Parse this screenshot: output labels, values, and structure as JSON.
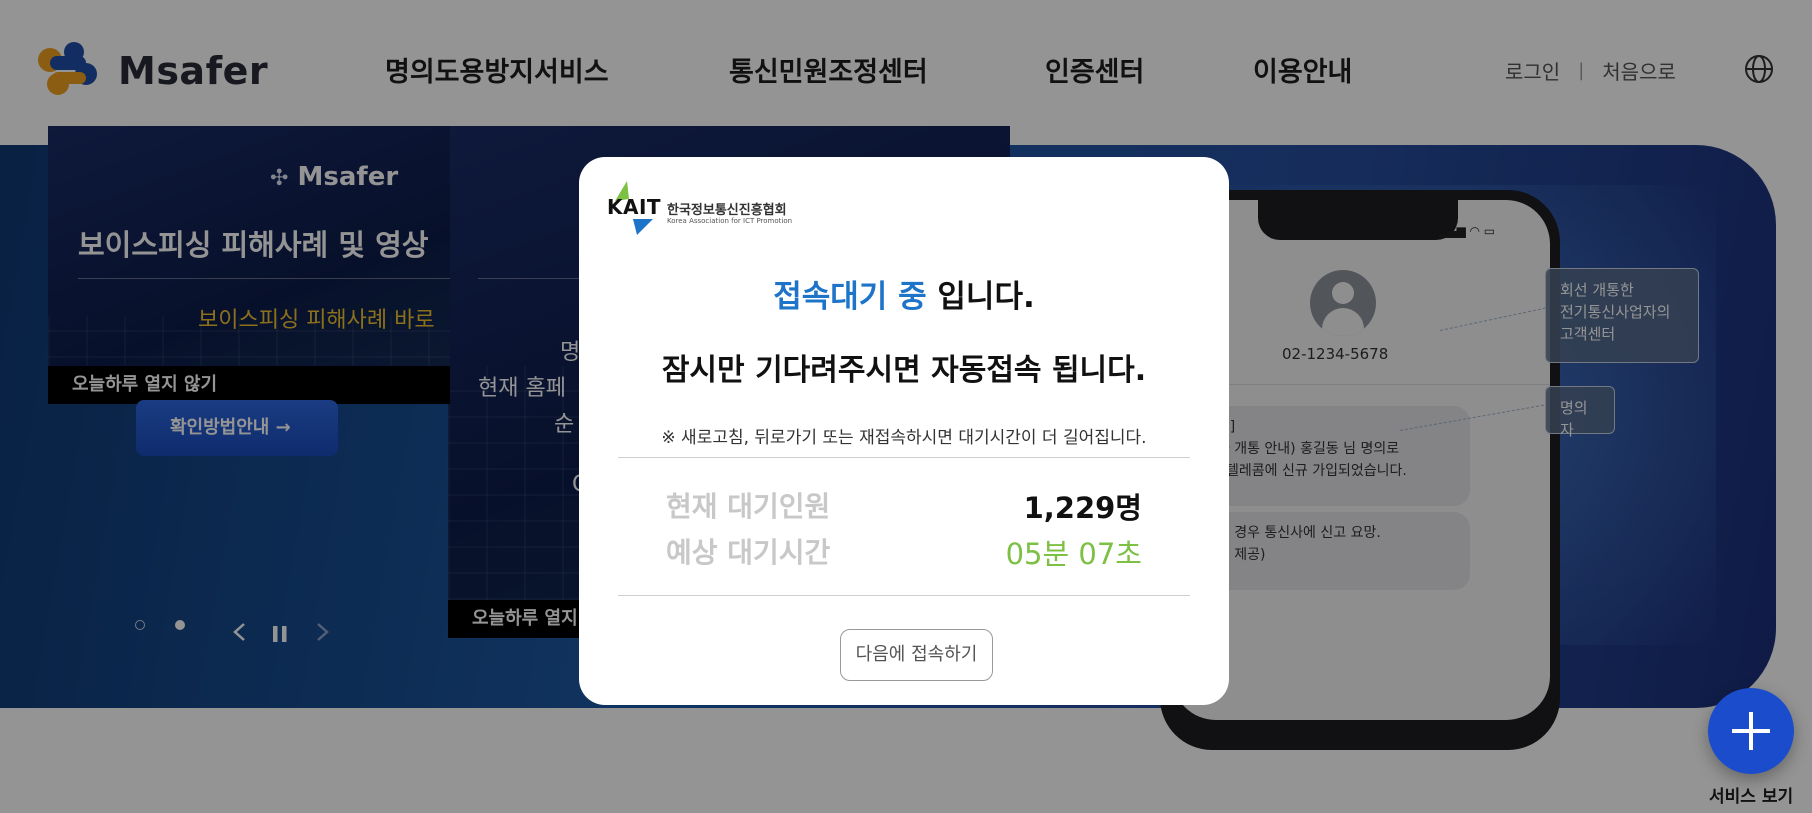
{
  "header": {
    "logo_text": "Msafer",
    "nav": [
      "명의도용방지서비스",
      "통신민원조정센터",
      "인증센터",
      "이용안내"
    ],
    "login_label": "로그인",
    "home_label": "처음으로",
    "globe_icon": "globe-icon"
  },
  "popup1": {
    "logo_text": "Msafer",
    "title": "보이스피싱 피해사례 및 영상",
    "subtitle": "보이스피싱 피해사례 바로",
    "close_today_label": "오늘하루 열지 않기",
    "confirm_label": "확인방법안내 →",
    "pager": {
      "dots": 2,
      "active_dot": 2
    }
  },
  "popup2": {
    "line1": "명",
    "line2": "현재 홈페",
    "line3": "순",
    "line4": "C",
    "close_today_label": "오늘하루 열지"
  },
  "phone_mock": {
    "phone_number": "02-1234-5678",
    "message1": [
      "발신]",
      "전화 개통 안내) 홍길동 님 명의로",
      "OO텔레콤에 신규 가입되었습니다."
    ],
    "message2": [
      "아닌 경우 통신사에 신고 요망.",
      "이퍼 제공)"
    ],
    "callout1": [
      "회선 개통한",
      "전기통신사업자의",
      "고객센터"
    ],
    "callout2": "명의자"
  },
  "modal": {
    "org_letters": "KAIT",
    "org_name": "한국정보통신진흥협회",
    "org_name_en": "Korea Association for ICT Promotion",
    "headline_accent": "접속대기 중",
    "headline_rest": " 입니다.",
    "subline": "잠시만 기다려주시면 자동접속 됩니다.",
    "notice": "※ 새로고침, 뒤로가기 또는 재접속하시면 대기시간이 더 길어집니다.",
    "queue_label": "현재 대기인원",
    "queue_value": "1,229명",
    "wait_label": "예상 대기시간",
    "wait_value": "05분 07초",
    "later_button": "다음에 접속하기"
  },
  "fab": {
    "label": "서비스 보기"
  },
  "colors": {
    "accent_blue": "#1e74c8",
    "wait_green": "#7cc044",
    "fab_blue": "#1a4ccc",
    "highlight_yellow": "#f2c230"
  }
}
